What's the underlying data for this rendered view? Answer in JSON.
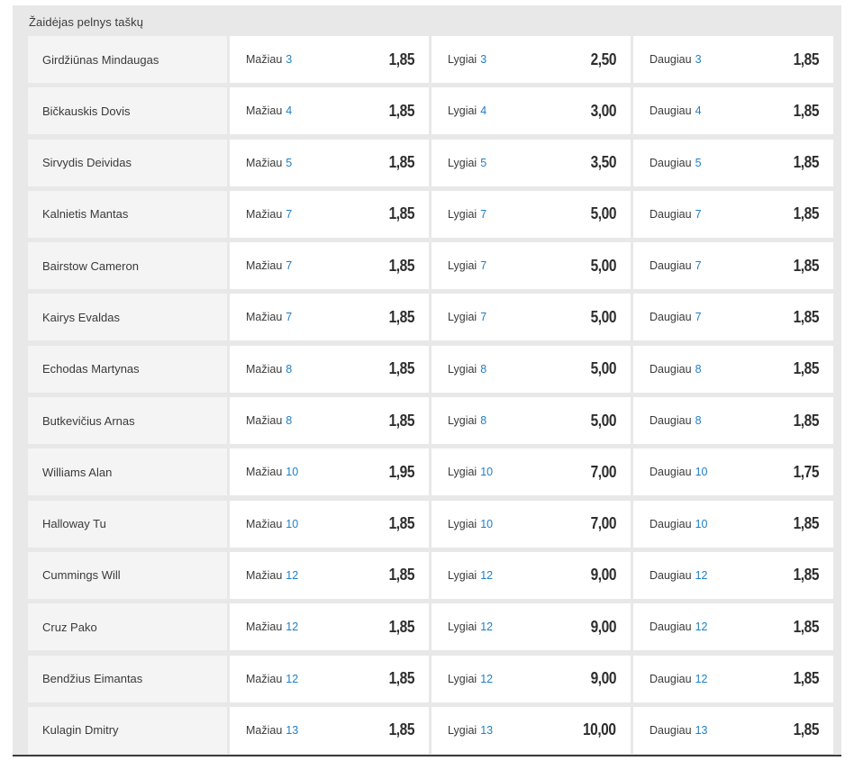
{
  "section": {
    "title": "Žaidėjas pelnys taškų"
  },
  "labels": {
    "under": "Mažiau",
    "equal": "Lygiai",
    "over": "Daugiau"
  },
  "rows": [
    {
      "player": "Girdžiūnas Mindaugas",
      "line": "3",
      "under": "1,85",
      "equal": "2,50",
      "over": "1,85"
    },
    {
      "player": "Bičkauskis Dovis",
      "line": "4",
      "under": "1,85",
      "equal": "3,00",
      "over": "1,85"
    },
    {
      "player": "Sirvydis Deividas",
      "line": "5",
      "under": "1,85",
      "equal": "3,50",
      "over": "1,85"
    },
    {
      "player": "Kalnietis Mantas",
      "line": "7",
      "under": "1,85",
      "equal": "5,00",
      "over": "1,85"
    },
    {
      "player": "Bairstow Cameron",
      "line": "7",
      "under": "1,85",
      "equal": "5,00",
      "over": "1,85"
    },
    {
      "player": "Kairys Evaldas",
      "line": "7",
      "under": "1,85",
      "equal": "5,00",
      "over": "1,85"
    },
    {
      "player": "Echodas Martynas",
      "line": "8",
      "under": "1,85",
      "equal": "5,00",
      "over": "1,85"
    },
    {
      "player": "Butkevičius Arnas",
      "line": "8",
      "under": "1,85",
      "equal": "5,00",
      "over": "1,85"
    },
    {
      "player": "Williams Alan",
      "line": "10",
      "under": "1,95",
      "equal": "7,00",
      "over": "1,75"
    },
    {
      "player": "Halloway Tu",
      "line": "10",
      "under": "1,85",
      "equal": "7,00",
      "over": "1,85"
    },
    {
      "player": "Cummings Will",
      "line": "12",
      "under": "1,85",
      "equal": "9,00",
      "over": "1,85"
    },
    {
      "player": "Cruz Pako",
      "line": "12",
      "under": "1,85",
      "equal": "9,00",
      "over": "1,85"
    },
    {
      "player": "Bendžius Eimantas",
      "line": "12",
      "under": "1,85",
      "equal": "9,00",
      "over": "1,85"
    },
    {
      "player": "Kulagin Dmitry",
      "line": "13",
      "under": "1,85",
      "equal": "10,00",
      "over": "1,85"
    }
  ]
}
